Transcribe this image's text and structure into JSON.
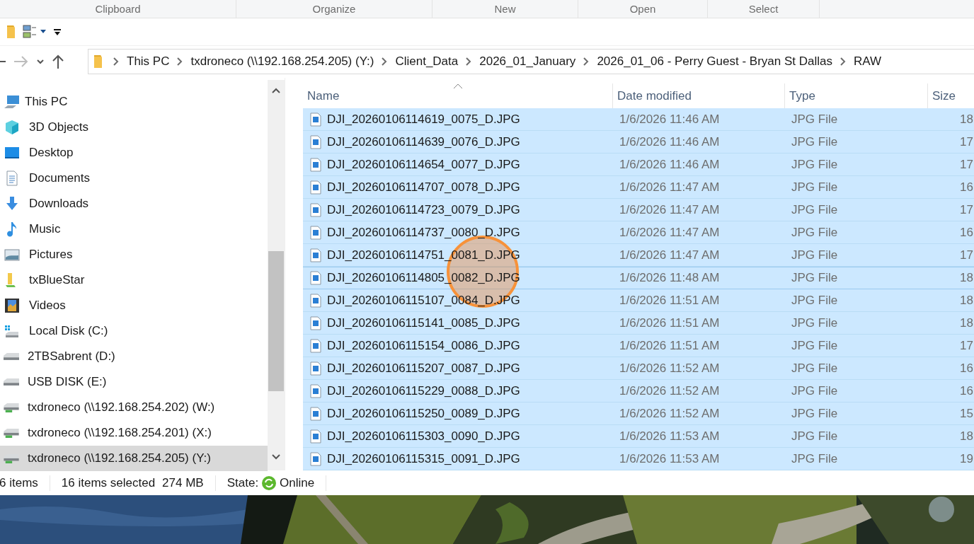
{
  "ribbon": {
    "groups": [
      "Clipboard",
      "Organize",
      "New",
      "Open",
      "Select"
    ]
  },
  "address_bar": {
    "crumbs": [
      "This PC",
      "txdroneco (\\\\192.168.254.205) (Y:)",
      "Client_Data",
      "2026_01_January",
      "2026_01_06 - Perry Guest - Bryan St Dallas",
      "RAW"
    ]
  },
  "navigation": {
    "items": [
      {
        "label": "This PC",
        "kind": "pc",
        "selected": false
      },
      {
        "label": "3D Objects",
        "kind": "cube",
        "selected": false
      },
      {
        "label": "Desktop",
        "kind": "desktop",
        "selected": false
      },
      {
        "label": "Documents",
        "kind": "documents",
        "selected": false
      },
      {
        "label": "Downloads",
        "kind": "downloads",
        "selected": false
      },
      {
        "label": "Music",
        "kind": "music",
        "selected": false
      },
      {
        "label": "Pictures",
        "kind": "pictures",
        "selected": false
      },
      {
        "label": "txBlueStar",
        "kind": "shared-folder",
        "selected": false
      },
      {
        "label": "Videos",
        "kind": "videos",
        "selected": false
      },
      {
        "label": "Local Disk (C:)",
        "kind": "system-drive",
        "selected": false
      },
      {
        "label": "2TBSabrent (D:)",
        "kind": "drive",
        "selected": false
      },
      {
        "label": "USB DISK (E:)",
        "kind": "drive",
        "selected": false
      },
      {
        "label": "txdroneco (\\\\192.168.254.202) (W:)",
        "kind": "network-drive",
        "selected": false
      },
      {
        "label": "txdroneco (\\\\192.168.254.201) (X:)",
        "kind": "network-drive",
        "selected": false
      },
      {
        "label": "txdroneco (\\\\192.168.254.205) (Y:)",
        "kind": "network-drive",
        "selected": true
      }
    ]
  },
  "file_list": {
    "columns": [
      {
        "label": "Name",
        "sorted": true
      },
      {
        "label": "Date modified",
        "sorted": false
      },
      {
        "label": "Type",
        "sorted": false
      },
      {
        "label": "Size",
        "sorted": false
      }
    ],
    "rows": [
      {
        "name": "DJI_20260106114619_0075_D.JPG",
        "date": "1/6/2026 11:46 AM",
        "type": "JPG File",
        "size": "18",
        "selected": true,
        "focused": false
      },
      {
        "name": "DJI_20260106114639_0076_D.JPG",
        "date": "1/6/2026 11:46 AM",
        "type": "JPG File",
        "size": "17",
        "selected": true,
        "focused": false
      },
      {
        "name": "DJI_20260106114654_0077_D.JPG",
        "date": "1/6/2026 11:46 AM",
        "type": "JPG File",
        "size": "17",
        "selected": true,
        "focused": false
      },
      {
        "name": "DJI_20260106114707_0078_D.JPG",
        "date": "1/6/2026 11:47 AM",
        "type": "JPG File",
        "size": "16",
        "selected": true,
        "focused": false
      },
      {
        "name": "DJI_20260106114723_0079_D.JPG",
        "date": "1/6/2026 11:47 AM",
        "type": "JPG File",
        "size": "17",
        "selected": true,
        "focused": false
      },
      {
        "name": "DJI_20260106114737_0080_D.JPG",
        "date": "1/6/2026 11:47 AM",
        "type": "JPG File",
        "size": "16",
        "selected": true,
        "focused": false
      },
      {
        "name": "DJI_20260106114751_0081_D.JPG",
        "date": "1/6/2026 11:47 AM",
        "type": "JPG File",
        "size": "17",
        "selected": true,
        "focused": false
      },
      {
        "name": "DJI_20260106114805_0082_D.JPG",
        "date": "1/6/2026 11:48 AM",
        "type": "JPG File",
        "size": "18",
        "selected": true,
        "focused": true
      },
      {
        "name": "DJI_20260106115107_0084_D.JPG",
        "date": "1/6/2026 11:51 AM",
        "type": "JPG File",
        "size": "18",
        "selected": true,
        "focused": false
      },
      {
        "name": "DJI_20260106115141_0085_D.JPG",
        "date": "1/6/2026 11:51 AM",
        "type": "JPG File",
        "size": "18",
        "selected": true,
        "focused": false
      },
      {
        "name": "DJI_20260106115154_0086_D.JPG",
        "date": "1/6/2026 11:51 AM",
        "type": "JPG File",
        "size": "17",
        "selected": true,
        "focused": false
      },
      {
        "name": "DJI_20260106115207_0087_D.JPG",
        "date": "1/6/2026 11:52 AM",
        "type": "JPG File",
        "size": "16",
        "selected": true,
        "focused": false
      },
      {
        "name": "DJI_20260106115229_0088_D.JPG",
        "date": "1/6/2026 11:52 AM",
        "type": "JPG File",
        "size": "16",
        "selected": true,
        "focused": false
      },
      {
        "name": "DJI_20260106115250_0089_D.JPG",
        "date": "1/6/2026 11:52 AM",
        "type": "JPG File",
        "size": "15",
        "selected": true,
        "focused": false
      },
      {
        "name": "DJI_20260106115303_0090_D.JPG",
        "date": "1/6/2026 11:53 AM",
        "type": "JPG File",
        "size": "18",
        "selected": true,
        "focused": false
      },
      {
        "name": "DJI_20260106115315_0091_D.JPG",
        "date": "1/6/2026 11:53 AM",
        "type": "JPG File",
        "size": "19",
        "selected": true,
        "focused": false
      }
    ]
  },
  "status_bar": {
    "item_count": "6 items",
    "selection": "16 items selected",
    "selection_size": "274 MB",
    "state_label": "State:",
    "state": "Online"
  }
}
